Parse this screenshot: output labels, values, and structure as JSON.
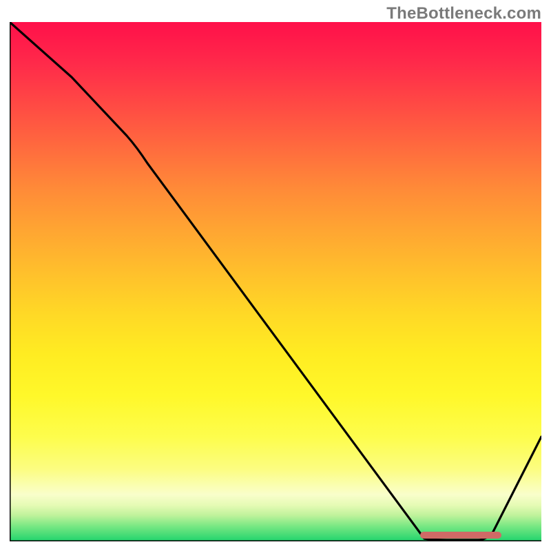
{
  "watermark": "TheBottleneck.com",
  "chart_data": {
    "type": "line",
    "title": "",
    "xlabel": "",
    "ylabel": "",
    "xlim": [
      0,
      100
    ],
    "ylim": [
      0,
      100
    ],
    "x": [
      0,
      22,
      78,
      85,
      100
    ],
    "values": [
      100,
      78,
      0,
      0,
      20
    ],
    "optimal_band": {
      "x_start": 77,
      "x_end": 89,
      "y": 1
    },
    "grid": false,
    "legend": false,
    "note": "Values are relative percentages read from the gradient/axes by position; no tick labels present."
  },
  "colors": {
    "curve": "#000000",
    "marker": "#d06a66",
    "axis": "#000000"
  }
}
